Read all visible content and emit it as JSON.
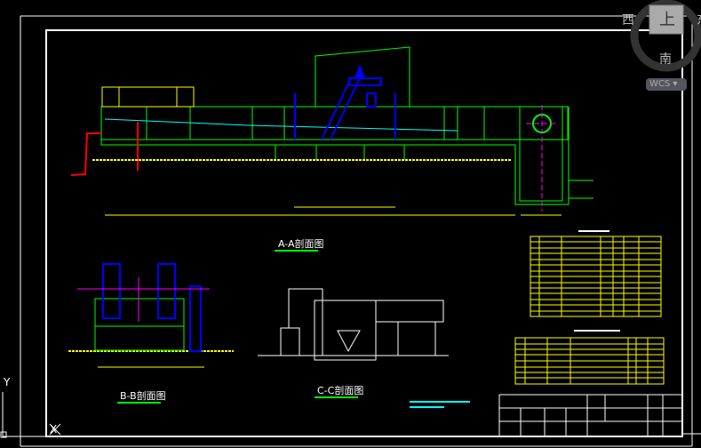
{
  "viewcube": {
    "face_top": "上",
    "west": "西",
    "south": "南",
    "east": "东",
    "coord_system": "WCS"
  },
  "ucs": {
    "x_label": "X",
    "y_label": "Y"
  },
  "sections": {
    "aa": "A-A剖面图",
    "bb": "B-B剖面图",
    "cc": "C-C剖面图"
  },
  "colors": {
    "frame": "#ffffff",
    "structure": "#00ff00",
    "equipment": "#0000ff",
    "tables": "#ffff00",
    "centerline": "#ff00ff",
    "water": "#00ffff",
    "pipe": "#ff0000"
  }
}
